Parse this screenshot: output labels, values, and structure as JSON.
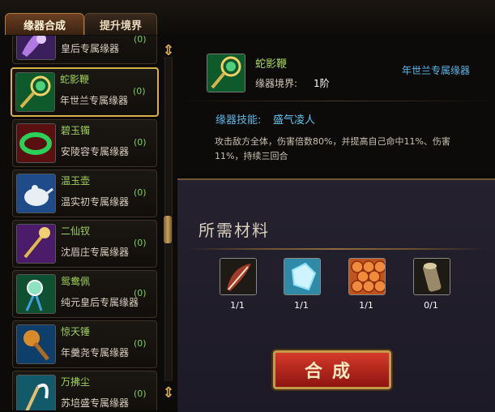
{
  "tabs": [
    {
      "label": "缘器合成",
      "active": true
    },
    {
      "label": "提升境界",
      "active": false
    }
  ],
  "list": {
    "items": [
      {
        "name": "",
        "desc": "皇后专属缘器",
        "count": "(0)",
        "icon": "purple-item-icon"
      },
      {
        "name": "蛇影鞭",
        "desc": "年世兰专属缘器",
        "count": "(0)",
        "icon": "whip-icon",
        "selected": true
      },
      {
        "name": "碧玉镯",
        "desc": "安陵容专属缘器",
        "count": "(0)",
        "icon": "bracelet-icon"
      },
      {
        "name": "温玉壶",
        "desc": "温实初专属缘器",
        "count": "(0)",
        "icon": "teapot-icon"
      },
      {
        "name": "二仙钗",
        "desc": "沈眉庄专属缘器",
        "count": "(0)",
        "icon": "hairpin-icon"
      },
      {
        "name": "鸳鸯佩",
        "desc": "纯元皇后专属缘器",
        "count": "(0)",
        "icon": "pendant-icon"
      },
      {
        "name": "惊天锤",
        "desc": "年羹尧专属缘器",
        "count": "(0)",
        "icon": "hammer-icon"
      },
      {
        "name": "万拂尘",
        "desc": "苏培盛专属缘器",
        "count": "(0)",
        "icon": "whisk-icon"
      }
    ]
  },
  "detail": {
    "name": "蛇影鞭",
    "realm_label": "缘器境界:",
    "realm_value": "1阶",
    "owner": "年世兰专属缘器",
    "skill_label": "缘器技能:",
    "skill_name": "盛气凌人",
    "skill_desc": "攻击敌方全体，伤害倍数80%，并提高自己命中11%、伤害11%，持续三回合"
  },
  "materials": {
    "title": "所需材料",
    "slots": [
      {
        "icon": "feather-icon",
        "count": "1/1"
      },
      {
        "icon": "crystal-icon",
        "count": "1/1"
      },
      {
        "icon": "scale-icon",
        "count": "1/1"
      },
      {
        "icon": "wood-icon",
        "count": "0/1"
      }
    ],
    "button": "合成"
  }
}
